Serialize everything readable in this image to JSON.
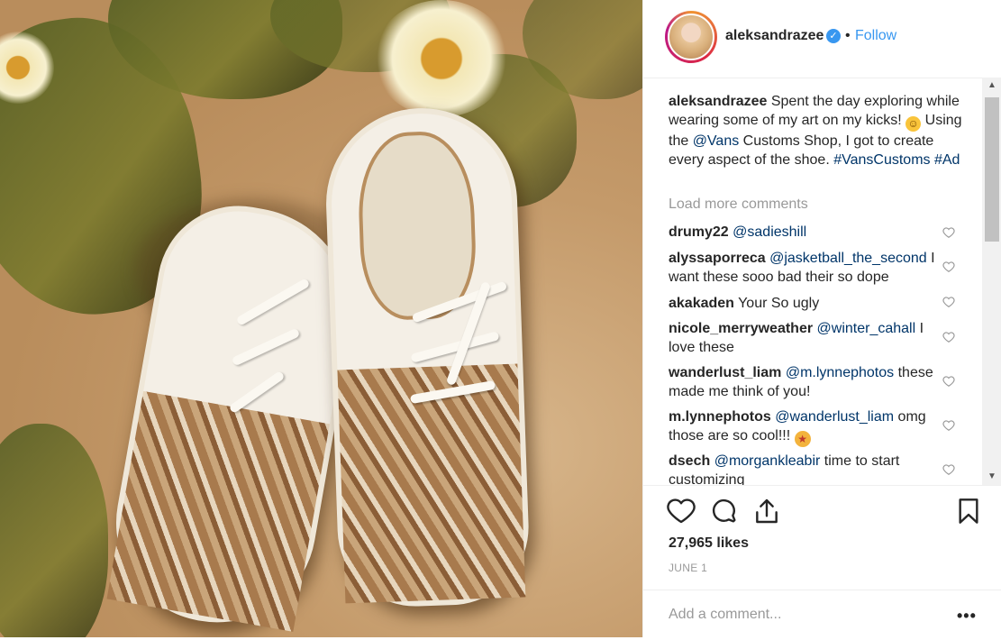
{
  "post": {
    "username": "aleksandrazee",
    "verified": true,
    "follow_dot": "•",
    "follow_label": "Follow"
  },
  "caption": {
    "username": "aleksandrazee",
    "text_1": " Spent the day exploring while wearing some of my art on my kicks! ",
    "text_2": " Using the ",
    "mention": "@Vans",
    "text_3": " Customs Shop, I got to create every aspect of the shoe. ",
    "hashtags": "#VansCustoms #Ad"
  },
  "load_more": "Load more comments",
  "comments": [
    {
      "user": "drumy22",
      "mention": "@sadieshill",
      "text": ""
    },
    {
      "user": "alyssaporreca",
      "mention": "@jasketball_the_second",
      "text": "I want these sooo bad their so dope"
    },
    {
      "user": "akakaden",
      "mention": "",
      "text": "Your So ugly"
    },
    {
      "user": "nicole_merryweather",
      "mention": "@winter_cahall",
      "text": "I love these"
    },
    {
      "user": "wanderlust_liam",
      "mention": "@m.lynnephotos",
      "text": "these made me think of you!"
    },
    {
      "user": "m.lynnephotos",
      "mention": "@wanderlust_liam",
      "text": "omg those are so cool!!!"
    },
    {
      "user": "dsech",
      "mention": "@morgankleabir",
      "text": "time to start customizing"
    }
  ],
  "likes": "27,965 likes",
  "date": "JUNE 1",
  "add_comment_placeholder": "Add a comment...",
  "more_label": "•••",
  "colors": {
    "link": "#003569",
    "follow": "#3897f0",
    "muted": "#999999",
    "text": "#262626"
  },
  "icons": {
    "verified": "verified-badge-icon",
    "like": "heart-icon",
    "comment": "comment-bubble-icon",
    "share": "share-icon",
    "save": "bookmark-icon",
    "more": "more-options-icon"
  }
}
